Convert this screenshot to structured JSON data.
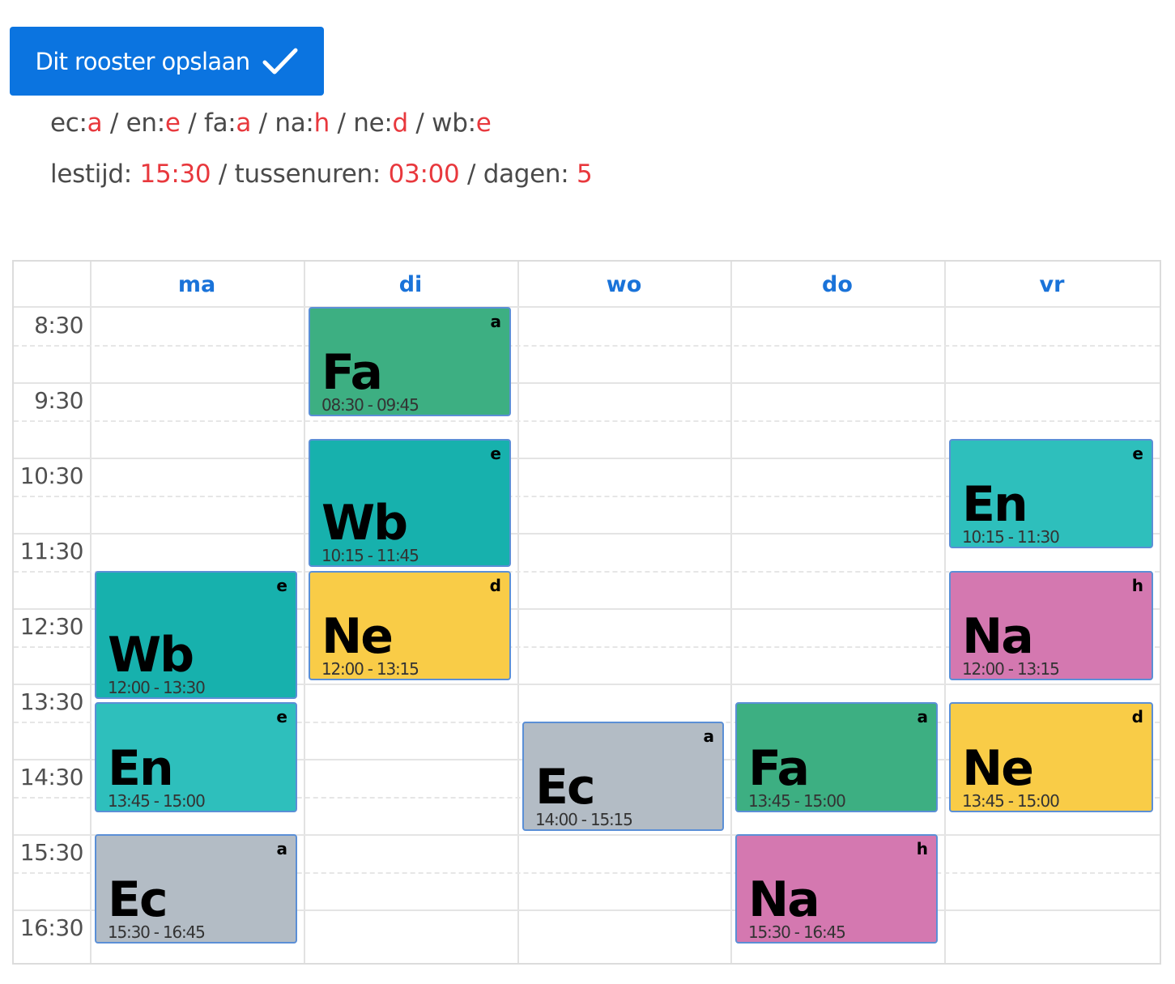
{
  "toolbar": {
    "save_label": "Dit rooster opslaan",
    "save_icon": "checkmark-icon"
  },
  "assignments": [
    {
      "subject": "ec",
      "level": "a"
    },
    {
      "subject": "en",
      "level": "e"
    },
    {
      "subject": "fa",
      "level": "a"
    },
    {
      "subject": "na",
      "level": "h"
    },
    {
      "subject": "ne",
      "level": "d"
    },
    {
      "subject": "wb",
      "level": "e"
    }
  ],
  "stats": {
    "lestijd_label": "lestijd:",
    "lestijd": "15:30",
    "tussenuren_label": "tussenuren:",
    "tussenuren": "03:00",
    "dagen_label": "dagen:",
    "dagen": "5"
  },
  "colors": {
    "accent": "#0b74e0",
    "value": "#e8383d",
    "day_header": "#1a73d9",
    "Fa": "#3daf82",
    "Wb": "#17b1ad",
    "En": "#2ebfbc",
    "Ne": "#f9cc47",
    "Na": "#d478b0",
    "Ec": "#b3bcc5"
  },
  "calendar": {
    "days": [
      "ma",
      "di",
      "wo",
      "do",
      "vr"
    ],
    "time_labels": [
      "8:30",
      "9:30",
      "10:30",
      "11:30",
      "12:30",
      "13:30",
      "14:30",
      "15:30",
      "16:30"
    ],
    "events": [
      {
        "day": 1,
        "subject": "Fa",
        "level": "a",
        "start": "08:30",
        "end": "09:45"
      },
      {
        "day": 1,
        "subject": "Wb",
        "level": "e",
        "start": "10:15",
        "end": "11:45"
      },
      {
        "day": 1,
        "subject": "Ne",
        "level": "d",
        "start": "12:00",
        "end": "13:15"
      },
      {
        "day": 0,
        "subject": "Wb",
        "level": "e",
        "start": "12:00",
        "end": "13:30"
      },
      {
        "day": 0,
        "subject": "En",
        "level": "e",
        "start": "13:45",
        "end": "15:00"
      },
      {
        "day": 0,
        "subject": "Ec",
        "level": "a",
        "start": "15:30",
        "end": "16:45"
      },
      {
        "day": 2,
        "subject": "Ec",
        "level": "a",
        "start": "14:00",
        "end": "15:15"
      },
      {
        "day": 3,
        "subject": "Fa",
        "level": "a",
        "start": "13:45",
        "end": "15:00"
      },
      {
        "day": 3,
        "subject": "Na",
        "level": "h",
        "start": "15:30",
        "end": "16:45"
      },
      {
        "day": 4,
        "subject": "En",
        "level": "e",
        "start": "10:15",
        "end": "11:30"
      },
      {
        "day": 4,
        "subject": "Na",
        "level": "h",
        "start": "12:00",
        "end": "13:15"
      },
      {
        "day": 4,
        "subject": "Ne",
        "level": "d",
        "start": "13:45",
        "end": "15:00"
      }
    ]
  }
}
